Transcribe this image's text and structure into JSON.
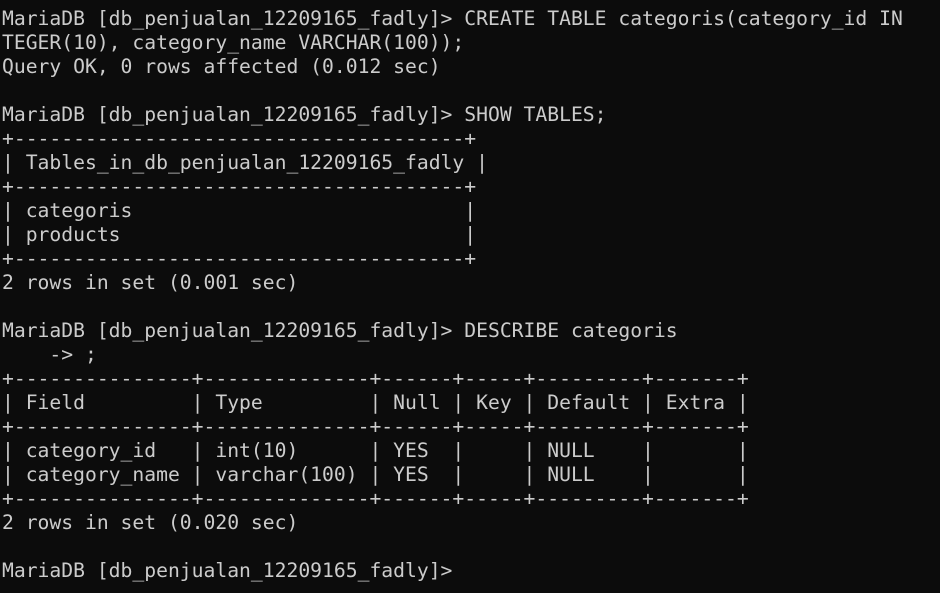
{
  "colors": {
    "background": "#0c0c0c",
    "text": "#cccccc"
  },
  "terminal": {
    "lines": [
      "MariaDB [db_penjualan_12209165_fadly]> CREATE TABLE categoris(category_id IN",
      "TEGER(10), category_name VARCHAR(100));",
      "Query OK, 0 rows affected (0.012 sec)",
      "",
      "MariaDB [db_penjualan_12209165_fadly]> SHOW TABLES;",
      "+--------------------------------------+",
      "| Tables_in_db_penjualan_12209165_fadly |",
      "+--------------------------------------+",
      "| categoris                            |",
      "| products                             |",
      "+--------------------------------------+",
      "2 rows in set (0.001 sec)",
      "",
      "MariaDB [db_penjualan_12209165_fadly]> DESCRIBE categoris",
      "    -> ;",
      "+---------------+--------------+------+-----+---------+-------+",
      "| Field         | Type         | Null | Key | Default | Extra |",
      "+---------------+--------------+------+-----+---------+-------+",
      "| category_id   | int(10)      | YES  |     | NULL    |       |",
      "| category_name | varchar(100) | YES  |     | NULL    |       |",
      "+---------------+--------------+------+-----+---------+-------+",
      "2 rows in set (0.020 sec)",
      "",
      "MariaDB [db_penjualan_12209165_fadly]>"
    ]
  }
}
